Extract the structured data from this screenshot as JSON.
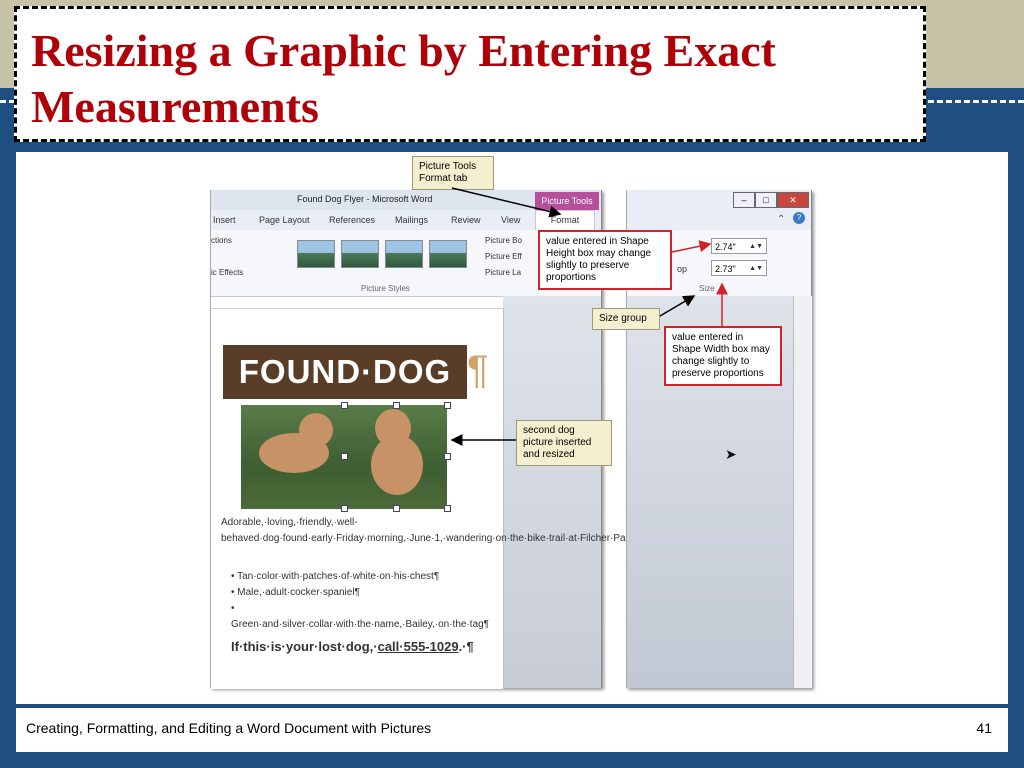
{
  "slide": {
    "title_line1": "Resizing a Graphic by Entering Exact",
    "title_line2": "Measurements",
    "footer_text": "Creating, Formatting, and Editing a Word Document with Pictures",
    "page_number": "41"
  },
  "word": {
    "window_title": "Found Dog Flyer - Microsoft Word",
    "contextual_tab": "Picture Tools",
    "tabs": [
      "Insert",
      "Page Layout",
      "References",
      "Mailings",
      "Review",
      "View",
      "Format"
    ],
    "ribbon_left": [
      "ctions",
      "ic Effects"
    ],
    "ribbon_items": [
      "Picture Bo",
      "Picture Eff",
      "Picture La"
    ],
    "group_label": "Picture Styles"
  },
  "document": {
    "banner": "FOUND·DOG",
    "pilcrow": "¶",
    "paragraph": "Adorable,·loving,·friendly,·well-behaved·dog·found·early·Friday·morning,·June·1,·wandering·on·the·bike·trail·at·Filcher·Park·in·Hampton·Township.¶",
    "bullets": [
      "• Tan·color·with·patches·of·white·on·his·chest¶",
      "• Male,·adult·cocker·spaniel¶",
      "• Green·and·silver·collar·with·the·name,·Bailey,·on·the·tag¶"
    ],
    "cta_prefix": "If·this·is·your·lost·dog,·",
    "cta_link": "call·555-1029",
    "cta_suffix": ".·¶"
  },
  "size_group": {
    "height_value": "2.74\"",
    "width_value": "2.73\"",
    "label": "Size",
    "crop_label": "op"
  },
  "callouts": {
    "picture_tools": "Picture Tools Format tab",
    "height": "value entered in Shape Height box may change slightly to preserve proportions",
    "size_group": "Size group",
    "width": "value entered in Shape Width box may change slightly to preserve proportions",
    "second_dog": "second dog picture inserted and resized"
  },
  "colors": {
    "title_red": "#b00008",
    "slide_blue": "#1f4e80",
    "callout_red": "#d2232a",
    "contextual_tab_pink": "#b64f9c"
  }
}
